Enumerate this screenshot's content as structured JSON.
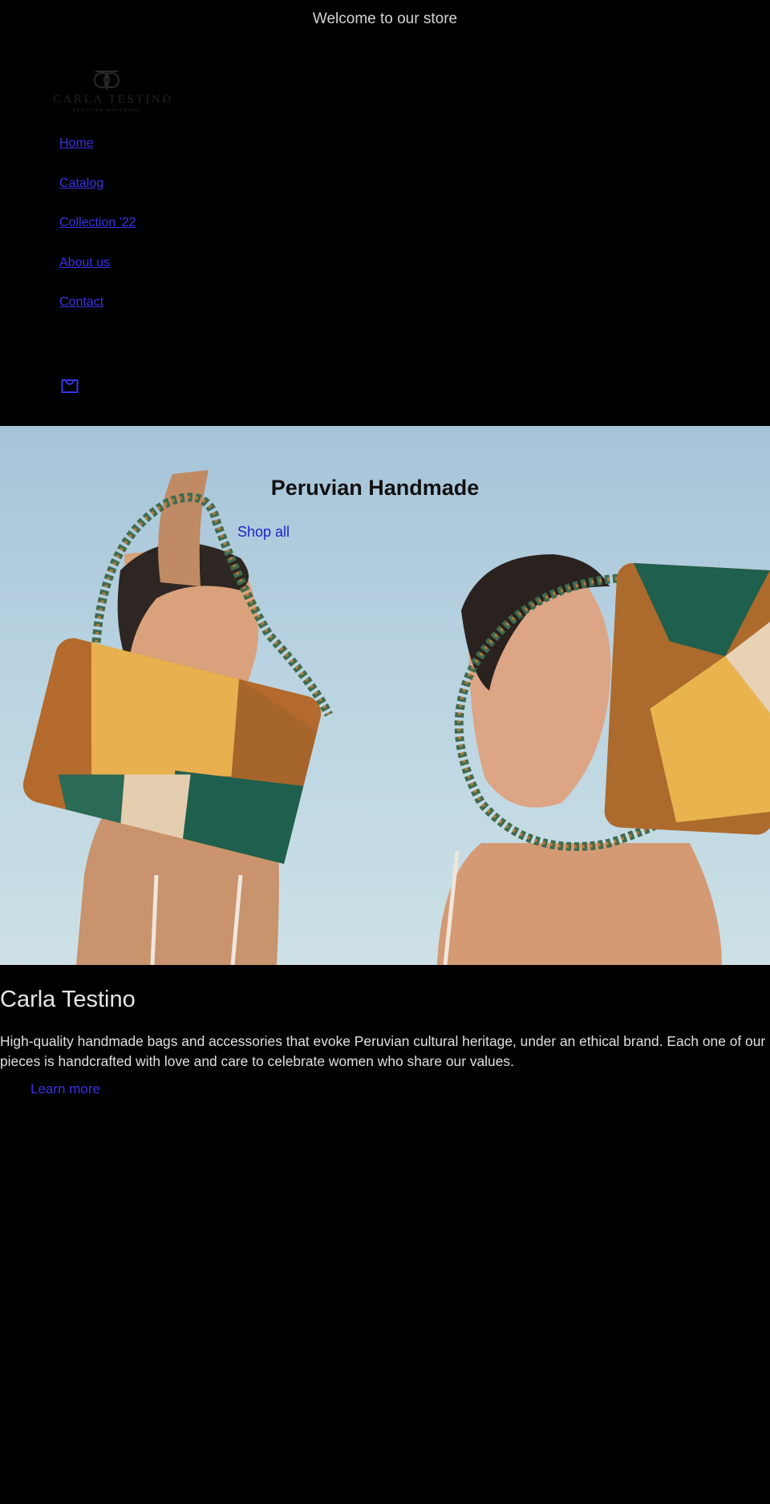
{
  "announcement": {
    "text": "Welcome to our store"
  },
  "brand": {
    "name": "CARLA TESTINO",
    "tagline": "PERUVIAN HANDMADE"
  },
  "nav": {
    "items": [
      {
        "label": "Home"
      },
      {
        "label": "Catalog"
      },
      {
        "label": "Collection '22"
      },
      {
        "label": "About us"
      },
      {
        "label": "Contact"
      }
    ]
  },
  "header": {
    "cart_icon": "bag-icon"
  },
  "hero": {
    "title": "Peruvian Handmade",
    "button_label": "Shop all"
  },
  "about": {
    "title": "Carla Testino",
    "body": "High-quality handmade bags and accessories that evoke Peruvian cultural heritage, under an ethical brand. Each one of our pieces is handcrafted with love and care to celebrate women who share our values.",
    "link_label": "Learn more"
  },
  "colors": {
    "background": "#000000",
    "link": "#3a33e8",
    "hero_sky": "#b9d3e1"
  }
}
